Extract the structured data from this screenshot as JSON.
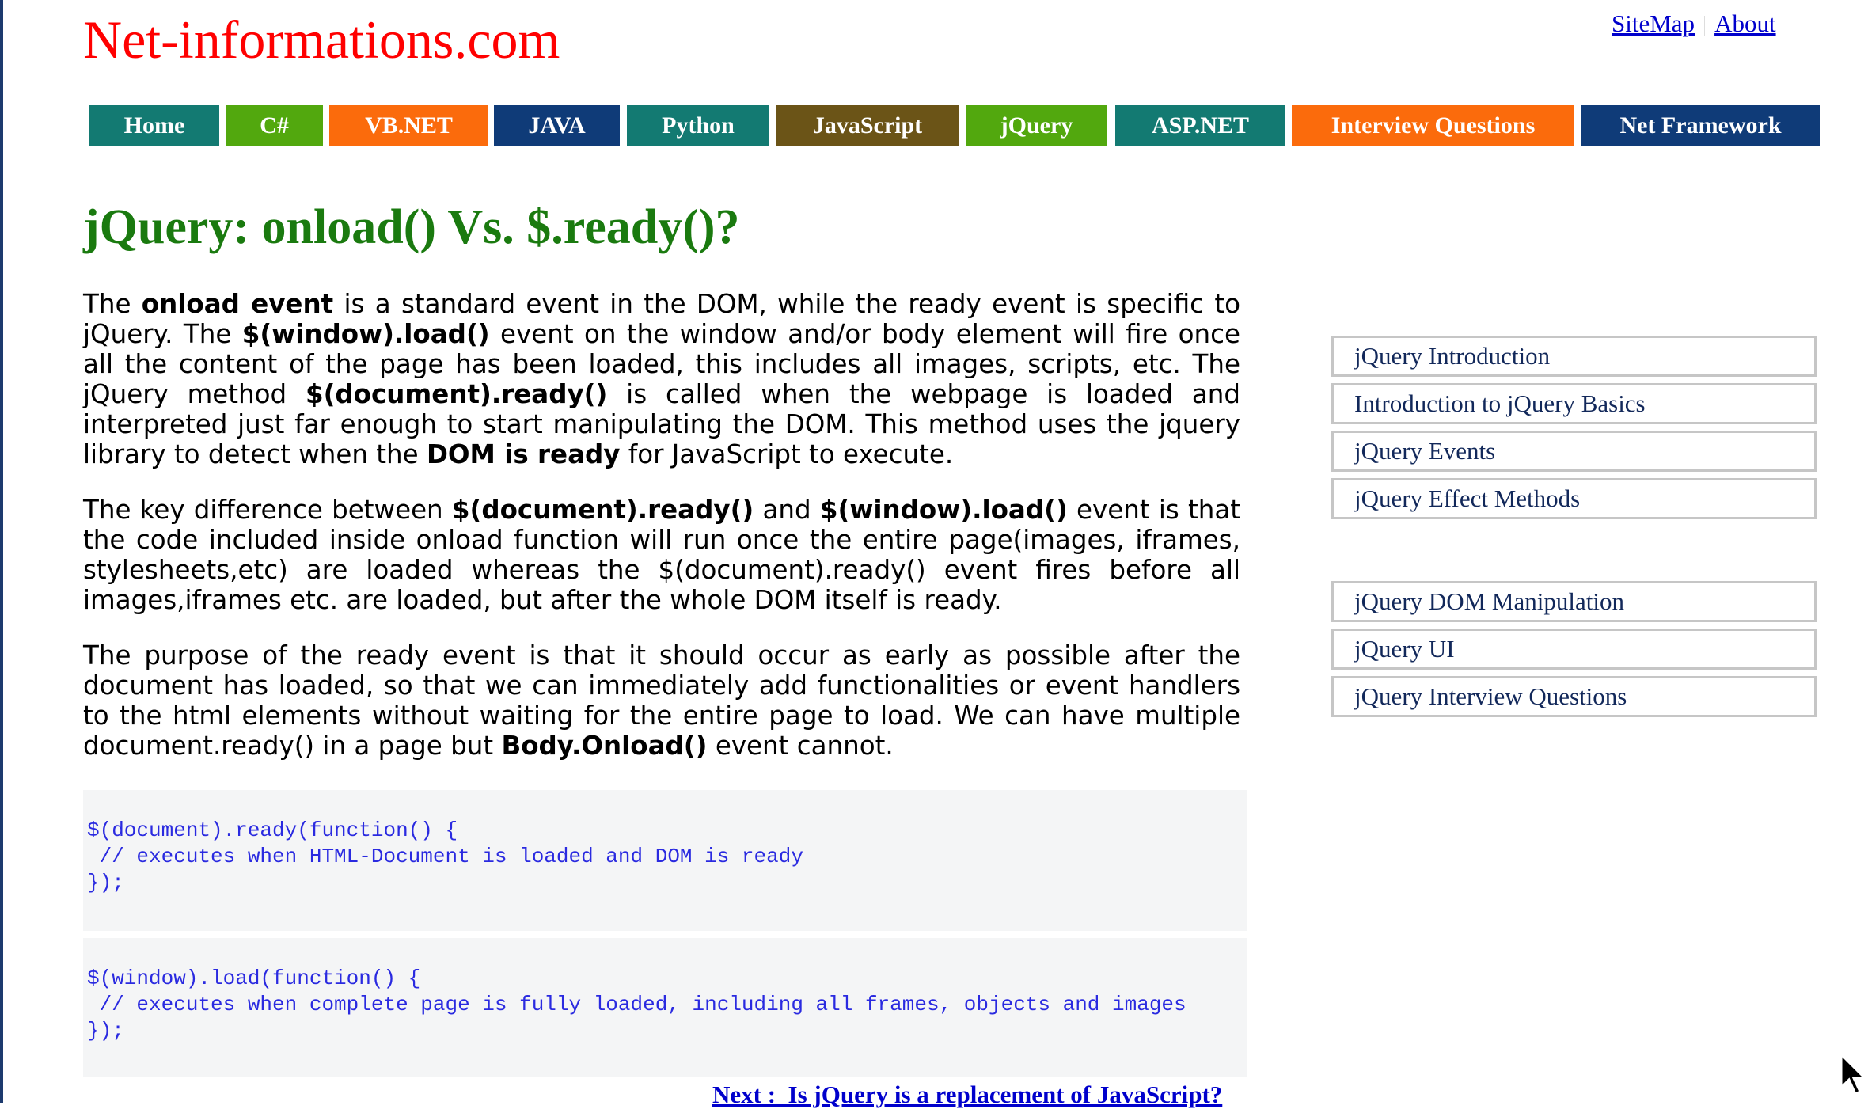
{
  "header": {
    "logo": "Net-informations.com",
    "links": [
      {
        "label": "SiteMap"
      },
      {
        "label": "About"
      }
    ]
  },
  "nav": {
    "items": [
      {
        "label": "Home",
        "color": "#137a72"
      },
      {
        "label": "C#",
        "color": "#52a80e"
      },
      {
        "label": "VB.NET",
        "color": "#fb6b0c"
      },
      {
        "label": "JAVA",
        "color": "#0f3b78"
      },
      {
        "label": "Python",
        "color": "#137a72"
      },
      {
        "label": "JavaScript",
        "color": "#6b5417"
      },
      {
        "label": "jQuery",
        "color": "#52a80e"
      },
      {
        "label": "ASP.NET",
        "color": "#137a72"
      },
      {
        "label": "Interview Questions",
        "color": "#fb6b0c"
      },
      {
        "label": "Net Framework",
        "color": "#0f3b78"
      }
    ]
  },
  "article": {
    "title": "jQuery: onload() Vs. $.ready()?",
    "p1": {
      "t1": "The ",
      "b1": "onload event",
      "t2": " is a standard event in the DOM, while the ready event is specific to jQuery. The ",
      "b2": "$(window).load()",
      "t3": " event on the window and/or body element will fire once all the content of the page has been loaded, this includes all images, scripts, etc. The jQuery method ",
      "b3": "$(document).ready()",
      "t4": " is called when the webpage is loaded and interpreted just far enough to start manipulating the DOM. This method uses the jquery library to detect when the ",
      "b4": "DOM is ready",
      "t5": " for JavaScript to execute."
    },
    "p2": {
      "t1": "The key difference between ",
      "b1": "$(document).ready()",
      "t2": " and ",
      "b2": "$(window).load()",
      "t3": " event is that the code included inside onload function will run once the entire page(images, iframes, stylesheets,etc) are loaded whereas the $(document).ready() event fires before all images,iframes etc. are loaded, but after the whole DOM itself is ready."
    },
    "p3": {
      "t1": "The purpose of the ready event is that it should occur as early as possible after the document has loaded, so that we can immediately add functionalities or event handlers to the html elements without waiting for the entire page to load. We can have multiple document.ready() in a page but ",
      "b1": "Body.Onload()",
      "t2": " event cannot."
    },
    "code1": "$(document).ready(function() {\n // executes when HTML-Document is loaded and DOM is ready\n});",
    "code2": "$(window).load(function() {\n // executes when complete page is fully loaded, including all frames, objects and images\n});",
    "next_link": "Next :  Is jQuery is a replacement of JavaScript?"
  },
  "sidebar": {
    "group1": [
      {
        "label": "jQuery Introduction"
      },
      {
        "label": "Introduction to jQuery Basics"
      },
      {
        "label": "jQuery Events"
      },
      {
        "label": "jQuery Effect Methods"
      }
    ],
    "group2": [
      {
        "label": "jQuery DOM Manipulation"
      },
      {
        "label": "jQuery UI"
      },
      {
        "label": "jQuery Interview Questions"
      }
    ]
  }
}
